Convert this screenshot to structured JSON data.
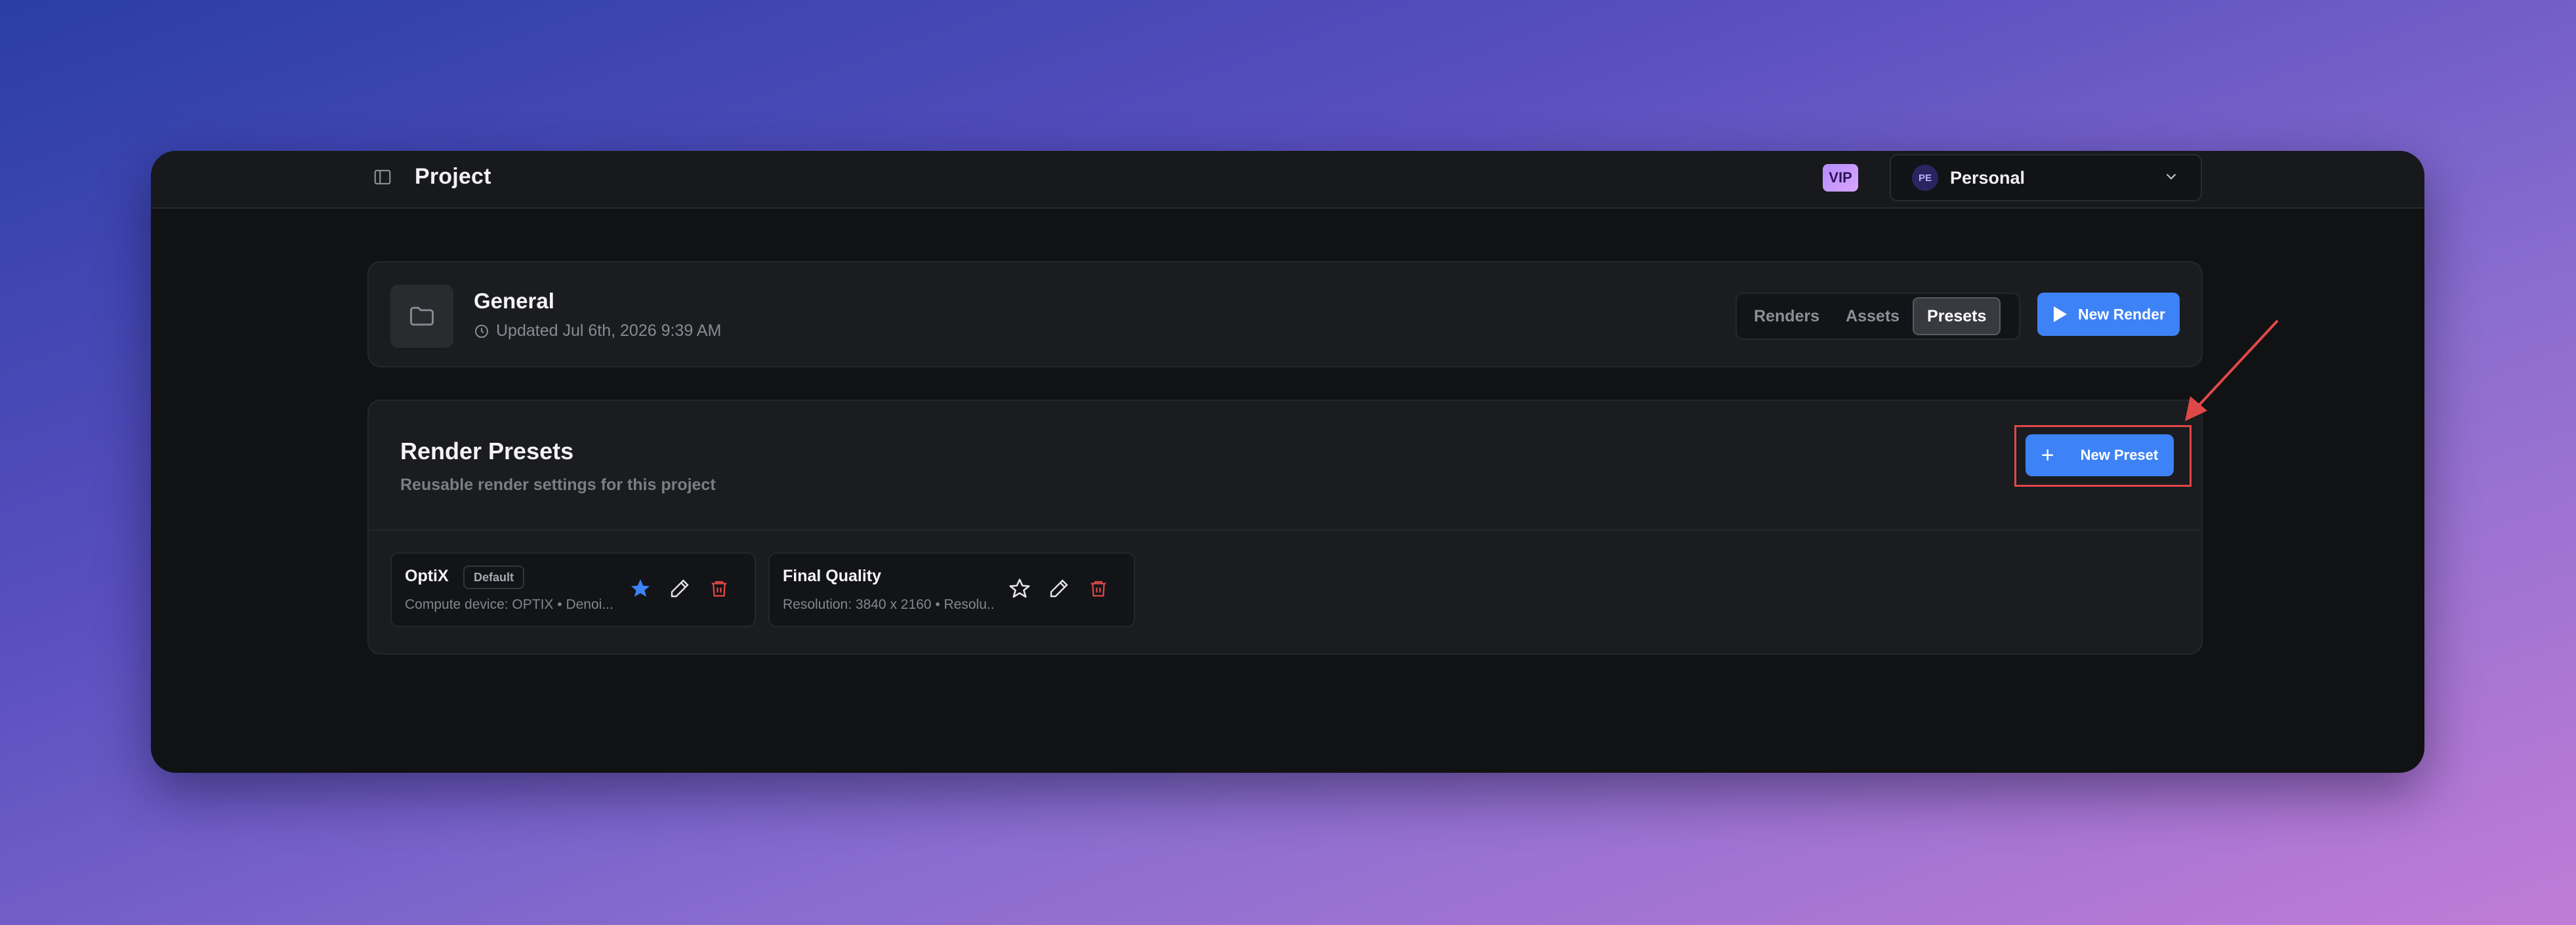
{
  "topbar": {
    "title": "Project",
    "vip_label": "VIP",
    "account": {
      "avatar_initials": "PE",
      "name": "Personal"
    }
  },
  "project": {
    "name": "General",
    "updated": "Updated Jul 6th, 2026 9:39 AM",
    "tabs": [
      {
        "label": "Renders",
        "active": false
      },
      {
        "label": "Assets",
        "active": false
      },
      {
        "label": "Presets",
        "active": true
      }
    ],
    "new_render_label": "New Render"
  },
  "presets": {
    "title": "Render Presets",
    "subtitle": "Reusable render settings for this project",
    "new_preset_label": "New Preset",
    "items": [
      {
        "name": "OptiX",
        "badge": "Default",
        "description": "Compute device: OPTIX • Denoi...",
        "starred": true
      },
      {
        "name": "Final Quality",
        "badge": "",
        "description": "Resolution: 3840 x 2160 • Resolu...",
        "starred": false
      }
    ]
  },
  "colors": {
    "accent": "#3d82f7",
    "danger": "#e04848",
    "star_active": "#3d82f7"
  }
}
